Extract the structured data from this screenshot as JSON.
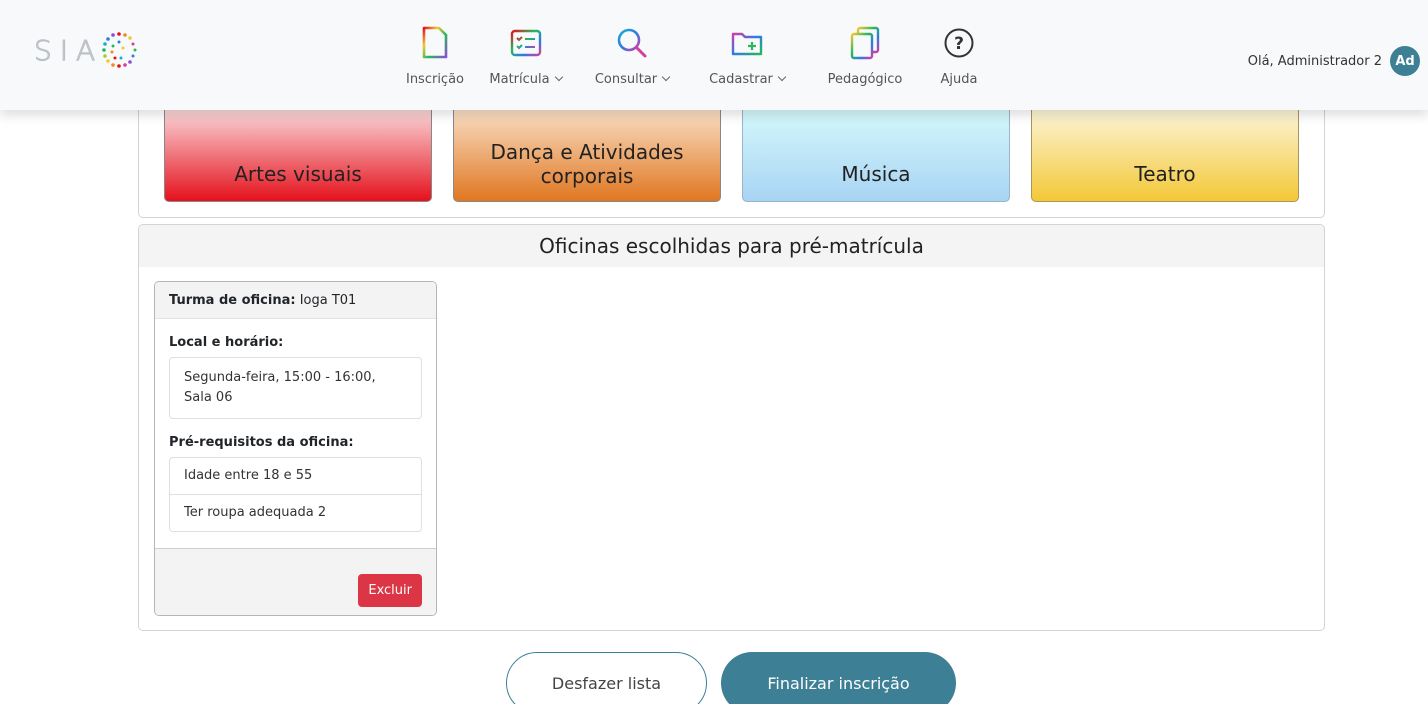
{
  "navbar": {
    "logo_text": "SIAC",
    "items": [
      {
        "label": "Inscrição",
        "icon": "document-icon",
        "dropdown": false
      },
      {
        "label": "Matrícula",
        "icon": "checklist-icon",
        "dropdown": true
      },
      {
        "label": "Consultar",
        "icon": "search-icon",
        "dropdown": true
      },
      {
        "label": "Cadastrar",
        "icon": "folder-plus-icon",
        "dropdown": true
      },
      {
        "label": "Pedagógico",
        "icon": "pages-icon",
        "dropdown": false
      },
      {
        "label": "Ajuda",
        "icon": "help-icon",
        "dropdown": false
      }
    ],
    "user_greeting": "Olá, Administrador 2",
    "avatar_initials": "Ad"
  },
  "categories": [
    {
      "label": "Artes visuais",
      "color_top": "#fbe8ea",
      "color_bottom": "#e5111c"
    },
    {
      "label": "Dança e Atividades corporais",
      "color_top": "#fbe7d2",
      "color_bottom": "#e07721"
    },
    {
      "label": "Música",
      "color_top": "#d8fbfb",
      "color_bottom": "#a8d4f4"
    },
    {
      "label": "Teatro",
      "color_top": "#fdf8e6",
      "color_bottom": "#f3c836"
    }
  ],
  "selected_section": {
    "title": "Oficinas escolhidas para pré-matrícula",
    "turma": {
      "label": "Turma de oficina:",
      "value": "Ioga T01",
      "location_title": "Local e horário:",
      "location": "Segunda-feira, 15:00 - 16:00, Sala 06",
      "prereq_title": "Pré-requisitos da oficina:",
      "prerequisites": [
        "Idade entre 18 e 55",
        "Ter roupa adequada 2"
      ],
      "delete_label": "Excluir"
    }
  },
  "actions": {
    "undo_label": "Desfazer lista",
    "finish_label": "Finalizar inscrição"
  },
  "colors": {
    "primary": "#3d7f94",
    "danger": "#dc3545"
  }
}
